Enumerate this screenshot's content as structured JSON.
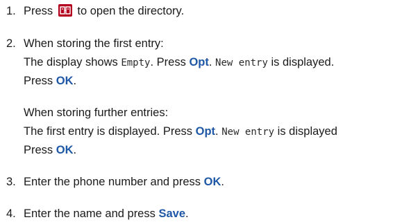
{
  "colors": {
    "keyword": "#1d57a5",
    "key_icon_bg": "#b4001e",
    "text": "#1a1a1a"
  },
  "steps": [
    {
      "number": "1.",
      "line1": {
        "before": "Press",
        "icon": "directory-book-icon",
        "after": "to open the directory."
      }
    },
    {
      "number": "2.",
      "first_heading": "When storing the first entry:",
      "first_line": {
        "t1": "The display shows",
        "lcd1": "Empty",
        "t2": ". Press",
        "kw1": "Opt",
        "t3": ".",
        "lcd2": "New entry",
        "t4": "is displayed."
      },
      "first_press": {
        "t": "Press",
        "kw": "OK",
        "end": "."
      },
      "further_heading": "When storing further entries:",
      "further_line": {
        "t1": "The first entry is displayed. Press",
        "kw1": "Opt",
        "t2": ".",
        "lcd1": "New entry",
        "t3": "is displayed"
      },
      "further_press": {
        "t": "Press",
        "kw": "OK",
        "end": "."
      }
    },
    {
      "number": "3.",
      "text": "Enter the phone number and press",
      "kw": "OK",
      "end": "."
    },
    {
      "number": "4.",
      "text": "Enter the name and press",
      "kw": "Save",
      "end": "."
    }
  ]
}
